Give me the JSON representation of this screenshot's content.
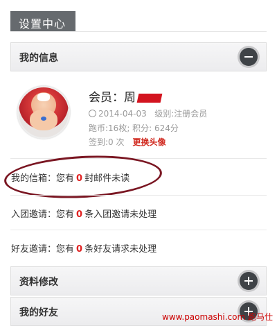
{
  "page_title": "设置中心",
  "my_info": {
    "header": "我的信息",
    "member_prefix": "会员：",
    "member_name_visible": "周",
    "date": "2014-04-03",
    "level_text": "级别:注册会员",
    "stats_line": "跑币:16枚; 积分: 624分",
    "checkin_text": "签到:0 次",
    "change_avatar": "更换头像"
  },
  "messages": [
    {
      "prefix": "我的信箱：您有",
      "count": "0",
      "suffix": "封邮件未读"
    },
    {
      "prefix": "入团邀请：您有",
      "count": "0",
      "suffix": "条入团邀请未处理"
    },
    {
      "prefix": "好友邀请：您有",
      "count": "0",
      "suffix": "条好友请求未处理"
    }
  ],
  "sections": {
    "profile_edit": "资料修改",
    "my_friends": "我的好友"
  },
  "watermark": "www.paomashi.com 跑马仕",
  "colors": {
    "accent_red": "#e02020",
    "circle_annotation": "#7a1622",
    "header_dark": "#666a6e"
  }
}
